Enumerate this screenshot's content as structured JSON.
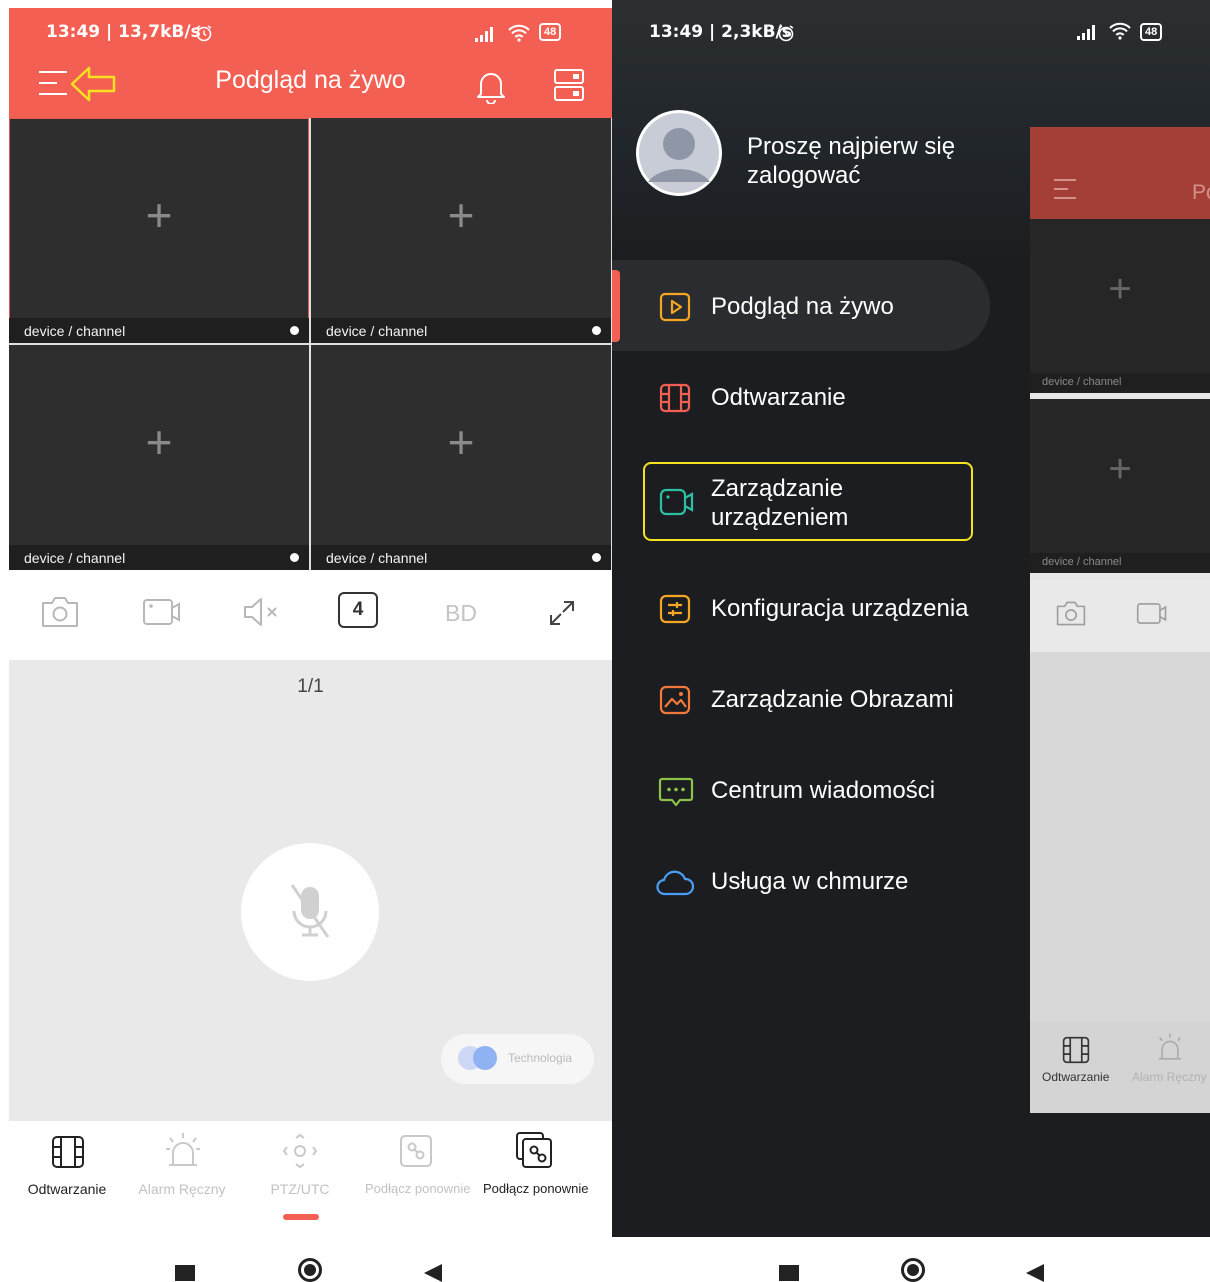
{
  "left": {
    "status": {
      "time": "13:49 | 13,7kB/s",
      "battery": "48"
    },
    "header": {
      "title": "Podgląd na żywo"
    },
    "cells": [
      {
        "label": "device / channel",
        "plus": "+"
      },
      {
        "label": "device / channel",
        "plus": "+"
      },
      {
        "label": "device / channel",
        "plus": "+"
      },
      {
        "label": "device / channel",
        "plus": "+"
      }
    ],
    "toolbar": {
      "split_count": "4",
      "quality": "BD"
    },
    "pager": "1/1",
    "tech_label": "Technologia",
    "bottom_tabs": [
      {
        "label": "Odtwarzanie",
        "icon": "film-icon"
      },
      {
        "label": "Alarm Ręczny",
        "icon": "alarm-icon"
      },
      {
        "label": "PTZ/UTC",
        "icon": "ptz-icon"
      },
      {
        "label": "Podłącz ponownie",
        "icon": "link-icon"
      },
      {
        "label": "Podłącz ponownie",
        "icon": "link-multi-icon"
      }
    ]
  },
  "right": {
    "status": {
      "time": "13:49 | 2,3kB/s",
      "battery": "48"
    },
    "login_prompt": "Proszę najpierw się zalogować",
    "menu": [
      {
        "label": "Podgląd na żywo",
        "icon": "play-icon",
        "color": "#f5a623"
      },
      {
        "label": "Odtwarzanie",
        "icon": "film-icon",
        "color": "#f45f53"
      },
      {
        "label": "Zarządzanie urządzeniem",
        "icon": "camera-icon",
        "color": "#2bbfa4"
      },
      {
        "label": "Konfiguracja urządzenia",
        "icon": "sliders-icon",
        "color": "#f5a623"
      },
      {
        "label": "Zarządzanie Obrazami",
        "icon": "image-icon",
        "color": "#f5793b"
      },
      {
        "label": "Centrum wiadomości",
        "icon": "message-icon",
        "color": "#8bc34a"
      },
      {
        "label": "Usługa w chmurze",
        "icon": "cloud-icon",
        "color": "#4a9ff5"
      }
    ],
    "peek": {
      "title_fragment": "Po",
      "cells": [
        {
          "label": "device / channel",
          "plus": "+"
        },
        {
          "label": "device / channel",
          "plus": "+"
        }
      ],
      "tabs": [
        {
          "label": "Odtwarzanie"
        },
        {
          "label": "Alarm Ręczny"
        }
      ]
    }
  }
}
